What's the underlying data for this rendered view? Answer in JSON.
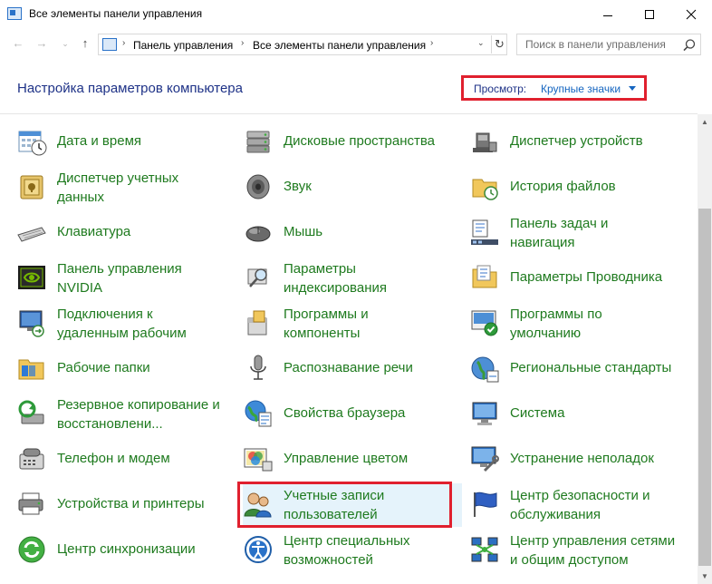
{
  "window": {
    "title": "Все элементы панели управления",
    "controls": {
      "minimize": "—",
      "maximize": "☐",
      "close": "✕"
    }
  },
  "nav": {
    "back": "←",
    "forward": "→",
    "recent": "⌄",
    "up": "↑",
    "breadcrumb": [
      "Панель управления",
      "Все элементы панели управления"
    ],
    "separator": "›",
    "dropdown": "⌄",
    "refresh": "↻",
    "search_placeholder": "Поиск в панели управления"
  },
  "header": {
    "title": "Настройка параметров компьютера",
    "view_label": "Просмотр:",
    "view_value": "Крупные значки"
  },
  "scrollbar": {
    "up": "▲",
    "down": "▼"
  },
  "colors": {
    "link_green": "#1e7a1e",
    "header_blue": "#1e3287",
    "highlight_border": "#e0202e",
    "hover_bg": "#e5f3fb"
  },
  "items": [
    {
      "label": "Дата и время",
      "icon": "calendar-clock-icon"
    },
    {
      "label": "Дисковые пространства",
      "icon": "storage-spaces-icon"
    },
    {
      "label": "Диспетчер устройств",
      "icon": "device-manager-icon"
    },
    {
      "label": "Диспетчер учетных\nданных",
      "icon": "credential-vault-icon"
    },
    {
      "label": "Звук",
      "icon": "speaker-icon"
    },
    {
      "label": "История файлов",
      "icon": "file-history-icon"
    },
    {
      "label": "Клавиатура",
      "icon": "keyboard-icon"
    },
    {
      "label": "Мышь",
      "icon": "mouse-icon"
    },
    {
      "label": "Панель задач и\nнавигация",
      "icon": "taskbar-icon"
    },
    {
      "label": "Панель управления\nNVIDIA",
      "icon": "nvidia-icon"
    },
    {
      "label": "Параметры\nиндексирования",
      "icon": "indexing-icon"
    },
    {
      "label": "Параметры Проводника",
      "icon": "explorer-options-icon"
    },
    {
      "label": "Подключения к\nудаленным рабочим",
      "icon": "remote-desktop-icon"
    },
    {
      "label": "Программы и\nкомпоненты",
      "icon": "programs-icon"
    },
    {
      "label": "Программы по\nумолчанию",
      "icon": "default-programs-icon"
    },
    {
      "label": "Рабочие папки",
      "icon": "work-folders-icon"
    },
    {
      "label": "Распознавание речи",
      "icon": "microphone-icon"
    },
    {
      "label": "Региональные стандарты",
      "icon": "region-globe-icon"
    },
    {
      "label": "Резервное копирование и\nвосстановлени...",
      "icon": "backup-restore-icon"
    },
    {
      "label": "Свойства браузера",
      "icon": "internet-options-icon"
    },
    {
      "label": "Система",
      "icon": "system-icon"
    },
    {
      "label": "Телефон и модем",
      "icon": "phone-modem-icon"
    },
    {
      "label": "Управление цветом",
      "icon": "color-management-icon"
    },
    {
      "label": "Устранение неполадок",
      "icon": "troubleshooting-icon"
    },
    {
      "label": "Устройства и принтеры",
      "icon": "printer-icon"
    },
    {
      "label": "Учетные записи\nпользователей",
      "icon": "user-accounts-icon"
    },
    {
      "label": "Центр безопасности и\nобслуживания",
      "icon": "security-flag-icon"
    },
    {
      "label": "Центр синхронизации",
      "icon": "sync-center-icon"
    },
    {
      "label": "Центр специальных\nвозможностей",
      "icon": "accessibility-icon"
    },
    {
      "label": "Центр управления сетями\nи общим доступом",
      "icon": "network-center-icon"
    }
  ]
}
